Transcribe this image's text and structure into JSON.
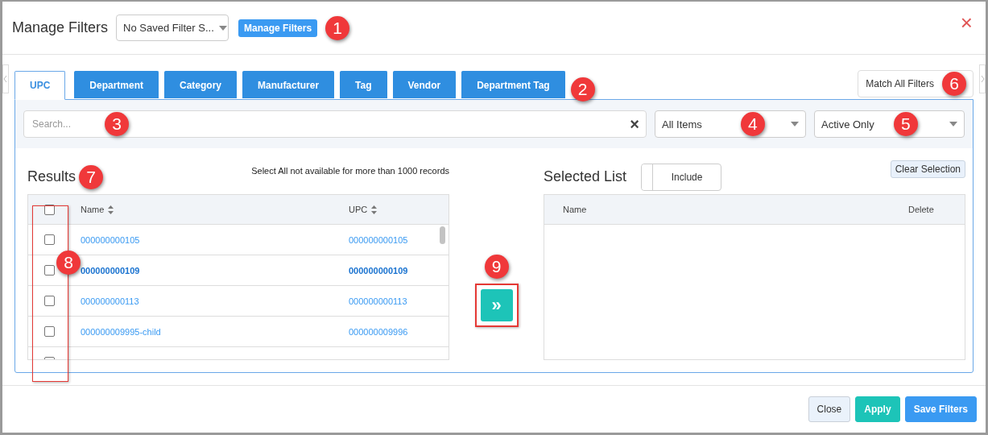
{
  "header": {
    "title": "Manage Filters",
    "saved_filter_select": {
      "value": "No Saved Filter S..."
    },
    "manage_button": "Manage Filters",
    "callout": "1",
    "close": "×"
  },
  "tabs": [
    {
      "label": "UPC",
      "selected": true
    },
    {
      "label": "Department",
      "selected": false
    },
    {
      "label": "Category",
      "selected": false
    },
    {
      "label": "Manufacturer",
      "selected": false
    },
    {
      "label": "Tag",
      "selected": false
    },
    {
      "label": "Vendor",
      "selected": false
    },
    {
      "label": "Department Tag",
      "selected": false
    }
  ],
  "tabs_callout": "2",
  "match_button": {
    "label": "Match All Filters",
    "callout": "6"
  },
  "filters": {
    "search": {
      "placeholder": "Search...",
      "clear": "×",
      "callout": "3"
    },
    "items_select": {
      "value": "All Items",
      "callout": "4"
    },
    "status_select": {
      "value": "Active Only",
      "callout": "5"
    }
  },
  "results": {
    "title": "Results",
    "callout": "7",
    "note": "Select All not available for more than 1000 records",
    "columns": [
      {
        "label": "Name"
      },
      {
        "label": "UPC"
      }
    ],
    "select_all": {
      "checked": false
    },
    "checkbox_callout": "8",
    "rows": [
      {
        "name": "000000000105",
        "upc": "000000000105",
        "checked": false,
        "highlighted": false
      },
      {
        "name": "000000000109",
        "upc": "000000000109",
        "checked": false,
        "highlighted": true
      },
      {
        "name": "000000000113",
        "upc": "000000000113",
        "checked": false,
        "highlighted": false
      },
      {
        "name": "000000009995-child",
        "upc": "000000009996",
        "checked": false,
        "highlighted": false
      },
      {
        "checked": false
      }
    ]
  },
  "move_button": {
    "label": "»",
    "callout": "9"
  },
  "selected_list": {
    "title": "Selected List",
    "include_toggle": {
      "label": "Include",
      "on": false
    },
    "clear_button": "Clear Selection",
    "columns": [
      {
        "label": "Name"
      },
      {
        "label": "Delete"
      }
    ]
  },
  "footer": {
    "buttons": [
      {
        "label": "Close",
        "kind": "secondary"
      },
      {
        "label": "Apply",
        "kind": "apply"
      },
      {
        "label": "Save Filters",
        "kind": "primary"
      }
    ]
  }
}
